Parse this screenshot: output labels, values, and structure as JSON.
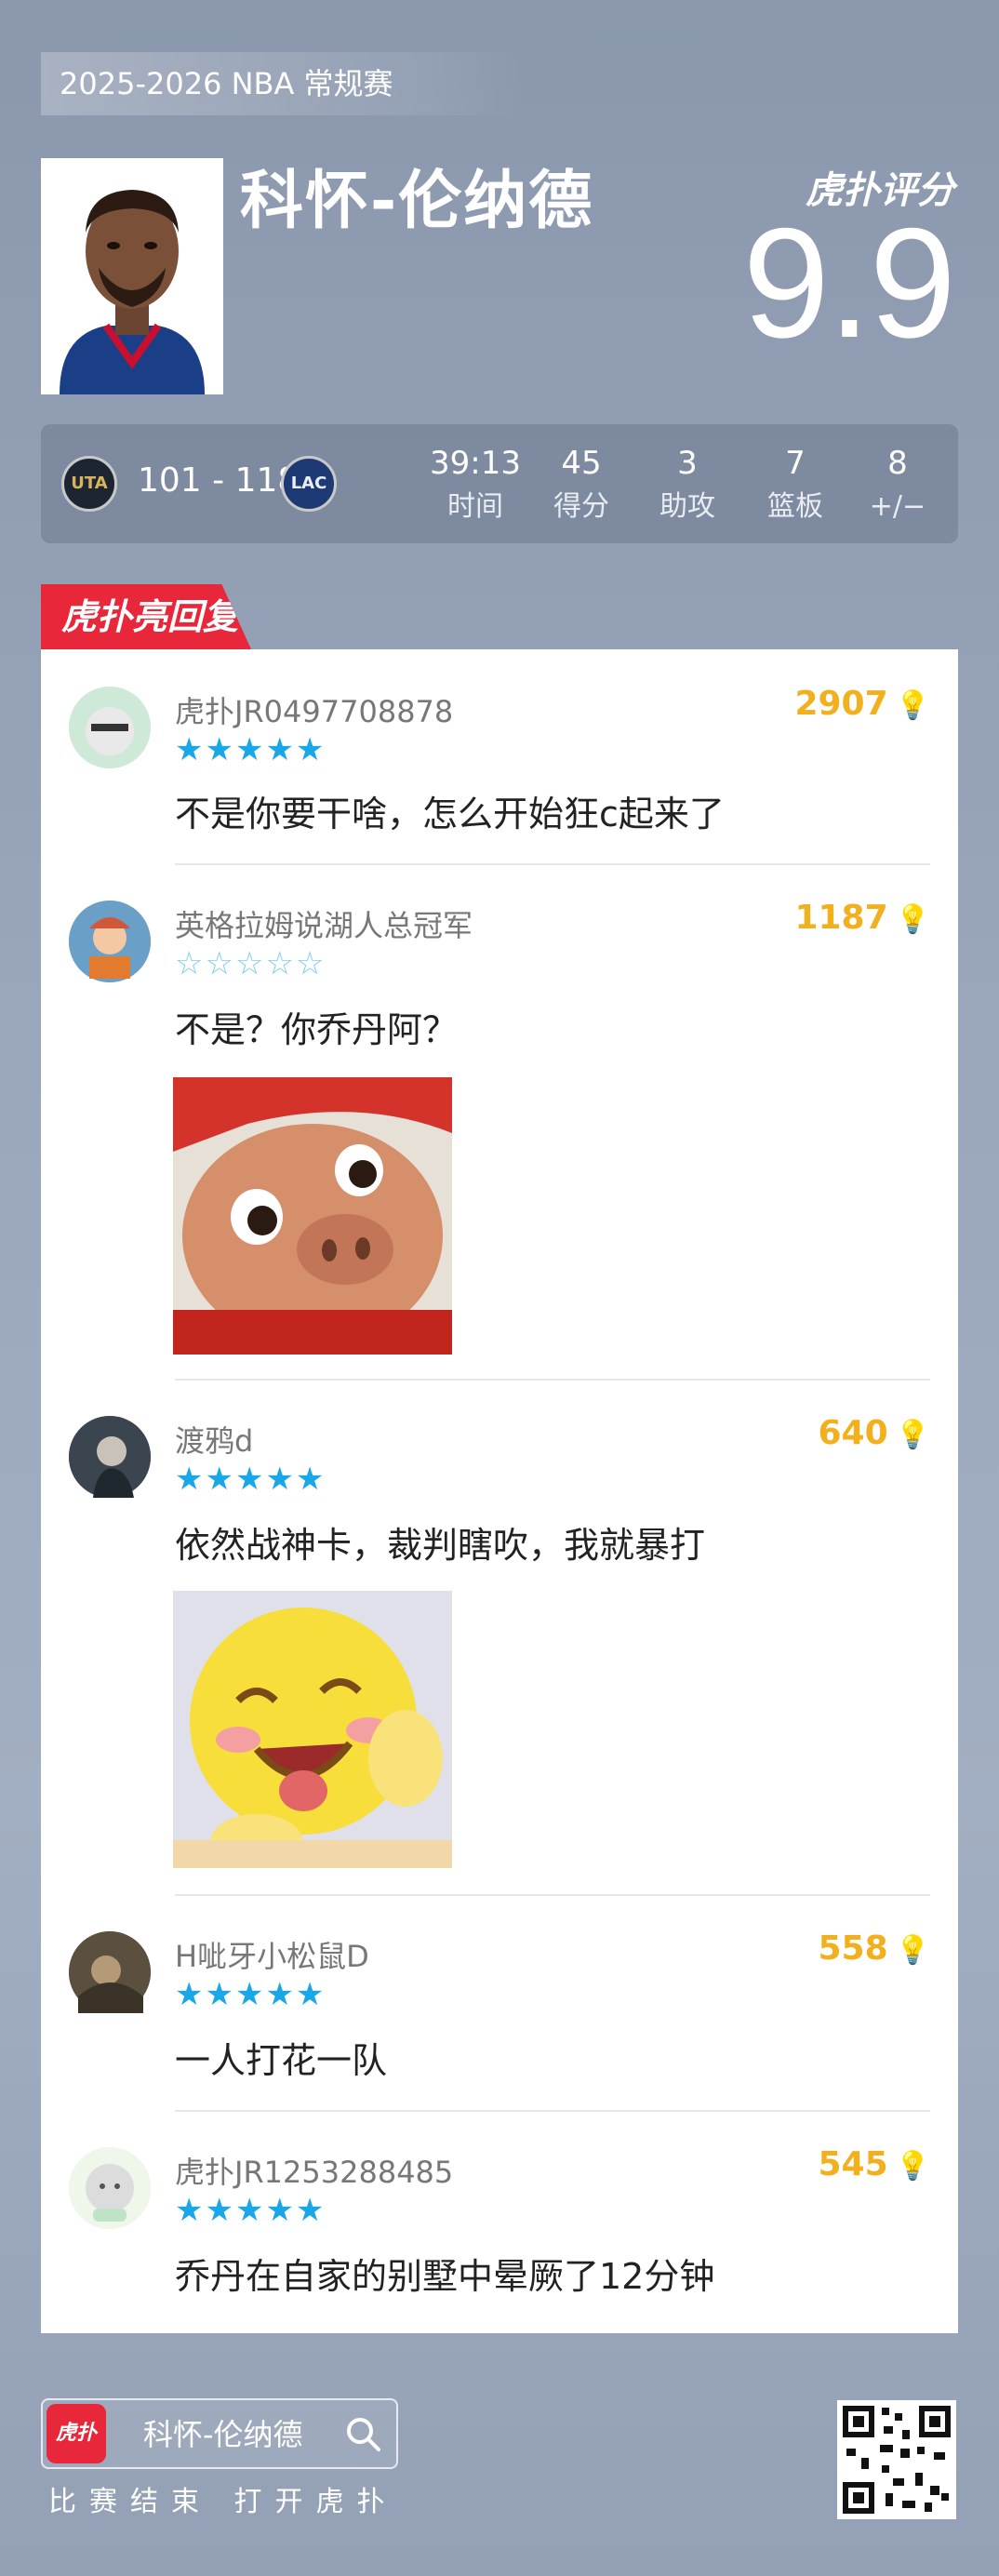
{
  "season": "2025-2026 NBA 常规赛",
  "player": {
    "name": "科怀-伦纳德"
  },
  "rating": {
    "brand": "虎扑评分",
    "value": "9.9"
  },
  "game": {
    "score": "101 - 118",
    "team_left_abbr": "UTA",
    "team_right_abbr": "LAC",
    "stats": [
      {
        "value": "39:13",
        "label": "时间"
      },
      {
        "value": "45",
        "label": "得分"
      },
      {
        "value": "3",
        "label": "助攻"
      },
      {
        "value": "7",
        "label": "篮板"
      },
      {
        "value": "8",
        "label": "+/−"
      }
    ]
  },
  "highlight_tab": "虎扑亮回复",
  "comments": [
    {
      "user": "虎扑JR0497708878",
      "stars": 5,
      "likes": "2907",
      "text": "不是你要干啥，怎么开始狂c起来了"
    },
    {
      "user": "英格拉姆说湖人总冠军",
      "stars": 0,
      "likes": "1187",
      "text": "不是？你乔丹阿？"
    },
    {
      "user": "渡鸦d",
      "stars": 5,
      "likes": "640",
      "text": "依然战神卡，裁判瞎吹，我就暴打"
    },
    {
      "user": "H呲牙小松鼠D",
      "stars": 5,
      "likes": "558",
      "text": "一人打花一队"
    },
    {
      "user": "虎扑JR1253288485",
      "stars": 5,
      "likes": "545",
      "text": "乔丹在自家的别墅中晕厥了12分钟"
    }
  ],
  "icons": {
    "like": "lightbulb-icon",
    "search": "search-icon",
    "star": "star-icon"
  },
  "colors": {
    "accent_red": "#e8283a",
    "star_blue": "#1aa7e8",
    "like_gold": "#f2b01e"
  },
  "footer": {
    "search_text": "科怀-伦纳德",
    "app_logo": "虎扑",
    "cta": "比赛结束 打开虎扑"
  }
}
